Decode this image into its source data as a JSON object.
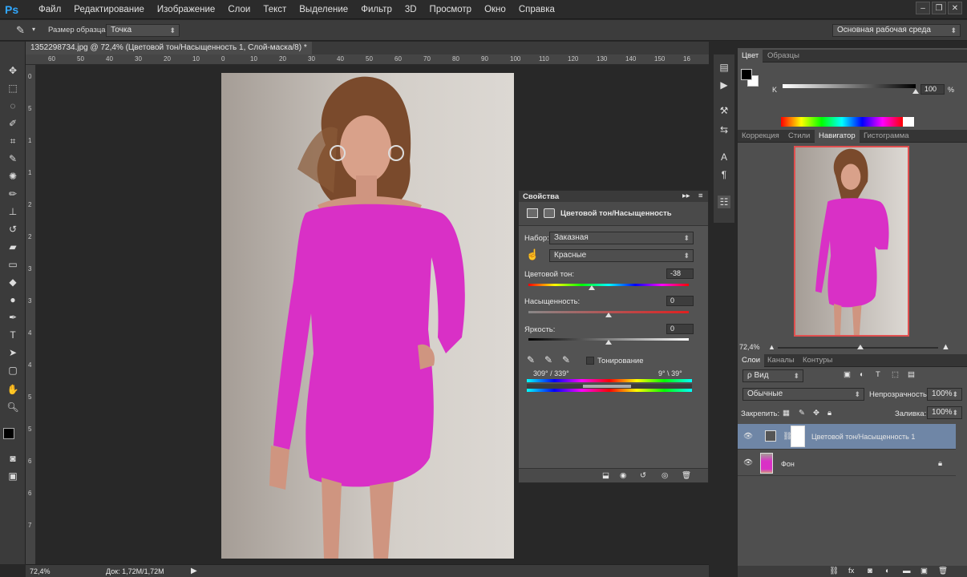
{
  "app": {
    "logo": "Ps"
  },
  "menu": [
    "Файл",
    "Редактирование",
    "Изображение",
    "Слои",
    "Текст",
    "Выделение",
    "Фильтр",
    "3D",
    "Просмотр",
    "Окно",
    "Справка"
  ],
  "options": {
    "sample_label": "Размер образца:",
    "sample_value": "Точка",
    "workspace": "Основная рабочая среда"
  },
  "document": {
    "tab_title": "1352298734.jpg @ 72,4% (Цветовой тон/Насыщенность 1, Слой-маска/8) *"
  },
  "ruler_top": [
    "60",
    "50",
    "40",
    "30",
    "20",
    "10",
    "0",
    "10",
    "20",
    "30",
    "40",
    "50",
    "60",
    "70",
    "80",
    "90",
    "100",
    "110",
    "120",
    "130",
    "140",
    "150",
    "16"
  ],
  "ruler_left": [
    "0",
    "5",
    "1",
    "1",
    "2",
    "2",
    "3",
    "3",
    "4",
    "4",
    "5",
    "5",
    "6",
    "6",
    "7"
  ],
  "properties": {
    "panel_title": "Свойства",
    "adjustment_title": "Цветовой тон/Насыщенность",
    "preset_label": "Набор:",
    "preset_value": "Заказная",
    "channel_value": "Красные",
    "hue_label": "Цветовой тон:",
    "hue_value": "-38",
    "saturation_label": "Насыщенность:",
    "saturation_value": "0",
    "lightness_label": "Яркость:",
    "lightness_value": "0",
    "colorize_label": "Тонирование",
    "range_left": "309° / 339°",
    "range_right": "9° \\ 39°"
  },
  "color_panel": {
    "tab_color": "Цвет",
    "tab_swatches": "Образцы",
    "k_label": "K",
    "k_value": "100",
    "k_unit": "%"
  },
  "navigator_panel": {
    "tabs": [
      "Коррекция",
      "Стили",
      "Навигатор",
      "Гистограмма"
    ],
    "active": "Навигатор",
    "zoom": "72,4%"
  },
  "layers_panel": {
    "tabs": [
      "Слои",
      "Каналы",
      "Контуры"
    ],
    "filter_value": "ρ Вид",
    "blend_mode": "Обычные",
    "opacity_label": "Непрозрачность:",
    "opacity_value": "100%",
    "lock_label": "Закрепить:",
    "fill_label": "Заливка:",
    "fill_value": "100%",
    "layers": [
      {
        "name": "Цветовой тон/Насыщенность 1",
        "selected": true
      },
      {
        "name": "Фон",
        "selected": false
      }
    ]
  },
  "status": {
    "zoom": "72,4%",
    "doc": "Док: 1,72M/1,72M"
  },
  "colors": {
    "accent": "#31a8ff",
    "dress": "#d930c6",
    "selected_layer": "#6f86a6"
  }
}
